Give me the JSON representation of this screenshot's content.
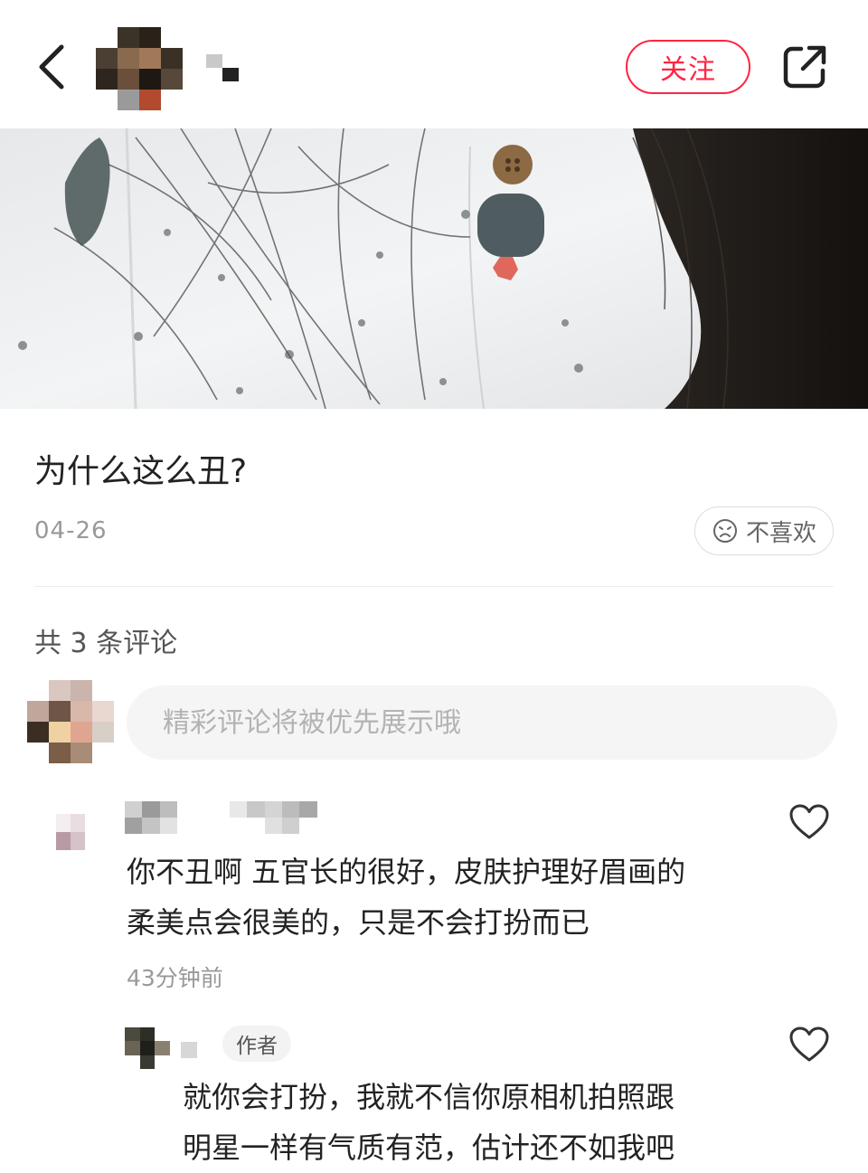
{
  "header": {
    "follow_label": "关注"
  },
  "post": {
    "title": "为什么这么丑?",
    "date": "04-26",
    "dislike_label": "不喜欢"
  },
  "comments_section": {
    "count_label": "共 3 条评论",
    "input_placeholder": "精彩评论将被优先展示哦",
    "comments": [
      {
        "line1": "你不丑啊 五官长的很好，皮肤护理好眉画的",
        "line2": "柔美点会很美的，只是不会打扮而已",
        "time": "43分钟前",
        "like_icon": "heart-outline-icon"
      }
    ],
    "reply": {
      "badge": "作者",
      "line1": "就你会打扮，我就不信你原相机拍照跟",
      "line2": "明星一样有气质有范，估计还不如我吧",
      "like_icon": "heart-outline-icon"
    }
  },
  "colors": {
    "accent": "#ff2442",
    "muted_text": "#999999",
    "input_bg": "#f5f5f5"
  }
}
